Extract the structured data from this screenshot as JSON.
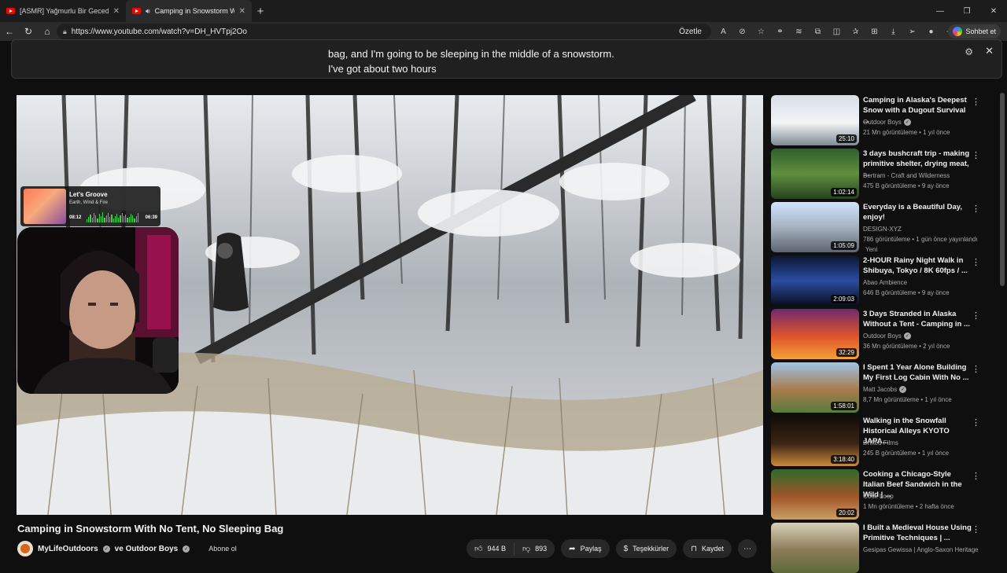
{
  "browser": {
    "tabs": [
      {
        "title": "[ASMR] Yağmurlu Bir Gecede Boş"
      },
      {
        "title": "Camping in Snowstorm With No Tent"
      }
    ],
    "new_tab": "+",
    "url": "https://www.youtube.com/watch?v=DH_HVTpj2Oo",
    "summarize_label": "Özetle",
    "copilot_label": "Sohbet et"
  },
  "captions": {
    "line1": "bag, and I'm going to be sleeping in the middle of a snowstorm.",
    "line2": "I've got about two hours"
  },
  "overlay": {
    "track": "Let's Groove",
    "artist": "Earth, Wind & Fire",
    "elapsed": "08:12",
    "total": "06:39"
  },
  "video": {
    "title": "Camping in Snowstorm With No Tent, No Sleeping Bag",
    "channel": "MyLifeOutdoors",
    "collab": "ve Outdoor Boys",
    "subscribe": "Abone ol",
    "likes": "944 B",
    "dislikes": "893",
    "share": "Paylaş",
    "thanks": "Teşekkürler",
    "save": "Kaydet"
  },
  "recommendations": [
    {
      "title": "Camping in Alaska's Deepest Snow with a Dugout Survival ...",
      "channel": "Outdoor Boys",
      "verified": true,
      "meta": "21 Mn görüntüleme • 1 yıl önce",
      "duration": "25:10",
      "theme": "cave"
    },
    {
      "title": "3 days bushcraft trip - making primitive shelter, drying meat, ...",
      "channel": "Bertram - Craft and Wilderness",
      "verified": false,
      "meta": "475 B görüntüleme • 9 ay önce",
      "duration": "1:02:14",
      "theme": "forest"
    },
    {
      "title": "Everyday is a Beautiful Day, enjoy!",
      "channel": "DESIGN-XYZ",
      "verified": false,
      "meta": "786 görüntüleme • 1 gün önce yayınlandı",
      "meta2": "Yeni",
      "duration": "1:05:09",
      "theme": "city"
    },
    {
      "title": "2-HOUR Rainy Night Walk in Shibuya, Tokyo / 8K 60fps / ...",
      "channel": "Abao Ambience",
      "verified": false,
      "meta": "646 B görüntüleme • 9 ay önce",
      "duration": "2:09:03",
      "theme": "night"
    },
    {
      "title": "3 Days Stranded in Alaska Without a Tent - Camping in ...",
      "channel": "Outdoor Boys",
      "verified": true,
      "meta": "36 Mn görüntüleme • 2 yıl önce",
      "duration": "32:29",
      "theme": "fire"
    },
    {
      "title": "I Spent 1 Year Alone Building My First Log Cabin With No ...",
      "channel": "Matt Jacobs",
      "verified": true,
      "meta": "8,7 Mn görüntüleme • 1 yıl önce",
      "duration": "1:58:01",
      "theme": "cabin"
    },
    {
      "title": "Walking in the Snowfall Historical Alleys KYOTO JAPA...",
      "channel": "Drifted Films",
      "verified": false,
      "meta": "245 B görüntüleme • 1 yıl önce",
      "duration": "3:18:40",
      "theme": "kyoto"
    },
    {
      "title": "Cooking a Chicago-Style Italian Beef Sandwich in the Wild | ...",
      "channel": "Cook Loop",
      "verified": false,
      "meta": "1 Mn görüntüleme • 2 hafta önce",
      "duration": "20:02",
      "theme": "food"
    },
    {
      "title": "I Built a Medieval House Using Primitive Techniques | ...",
      "channel": "Gesipas Gewissa | Anglo-Saxon Heritage",
      "verified": false,
      "meta": "",
      "duration": "",
      "theme": "medieval"
    }
  ],
  "colors": {
    "accent": "#ff0000",
    "background": "#0f0f0f",
    "eq": "#3ad14c"
  }
}
